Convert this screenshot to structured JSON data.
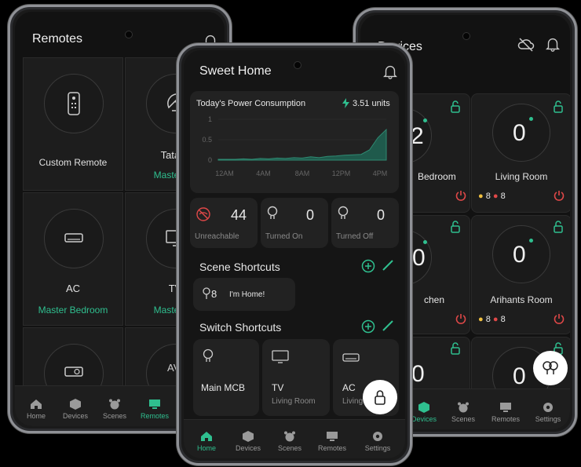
{
  "left_phone": {
    "title": "Remotes",
    "cells": [
      {
        "label": "Custom Remote",
        "sub": ""
      },
      {
        "label": "Tata S",
        "sub": "Master Be"
      },
      {
        "label": "AC",
        "sub": "Master Bedroom"
      },
      {
        "label": "TV",
        "sub": "Master Be"
      },
      {
        "label": "",
        "sub": ""
      },
      {
        "label": "AV",
        "sub": ""
      }
    ],
    "nav": [
      "Home",
      "Devices",
      "Scenes",
      "Remotes",
      "Settings"
    ],
    "active_nav": "Remotes"
  },
  "right_phone": {
    "title": "Devices",
    "rooms": [
      {
        "count": "2",
        "name": "Bedroom",
        "stat_a": "",
        "stat_b": ""
      },
      {
        "count": "0",
        "name": "Living Room",
        "stat_a": "8",
        "stat_b": "8"
      },
      {
        "count": "0",
        "name": "chen",
        "stat_a": "",
        "stat_b": ""
      },
      {
        "count": "0",
        "name": "Arihants Room",
        "stat_a": "8",
        "stat_b": "8"
      },
      {
        "count": "0",
        "name": "",
        "stat_a": "",
        "stat_b": ""
      },
      {
        "count": "0",
        "name": "",
        "stat_a": "",
        "stat_b": ""
      }
    ],
    "nav": [
      "Devices",
      "Scenes",
      "Remotes",
      "Settings"
    ],
    "active_nav": "Devices"
  },
  "center_phone": {
    "title": "Sweet Home",
    "power": {
      "label": "Today's Power Consumption",
      "value": "3.51 units"
    },
    "chart_data": {
      "type": "area",
      "x": [
        "12AM",
        "4AM",
        "8AM",
        "12PM",
        "4PM"
      ],
      "yticks": [
        "1",
        "0.5",
        "0"
      ],
      "ylim": [
        0,
        1
      ],
      "values": [
        0.02,
        0.02,
        0.02,
        0.03,
        0.02,
        0.04,
        0.03,
        0.05,
        0.04,
        0.06,
        0.05,
        0.08,
        0.06,
        0.09,
        0.1,
        0.12,
        0.13,
        0.14,
        0.25,
        0.55,
        0.75
      ]
    },
    "stats": [
      {
        "value": "44",
        "label": "Unreachable"
      },
      {
        "value": "0",
        "label": "Turned On"
      },
      {
        "value": "0",
        "label": "Turned Off"
      }
    ],
    "scene_header": "Scene Shortcuts",
    "scene": {
      "count": "8",
      "label": "I'm Home!"
    },
    "switch_header": "Switch Shortcuts",
    "switches": [
      {
        "name": "Main MCB",
        "room": ""
      },
      {
        "name": "TV",
        "room": "Living Room"
      },
      {
        "name": "AC",
        "room": "Living"
      }
    ],
    "nav": [
      "Home",
      "Devices",
      "Scenes",
      "Remotes",
      "Settings"
    ],
    "active_nav": "Home"
  },
  "colors": {
    "accent": "#2fbf8f",
    "danger": "#e04848",
    "warn": "#f0c040"
  }
}
